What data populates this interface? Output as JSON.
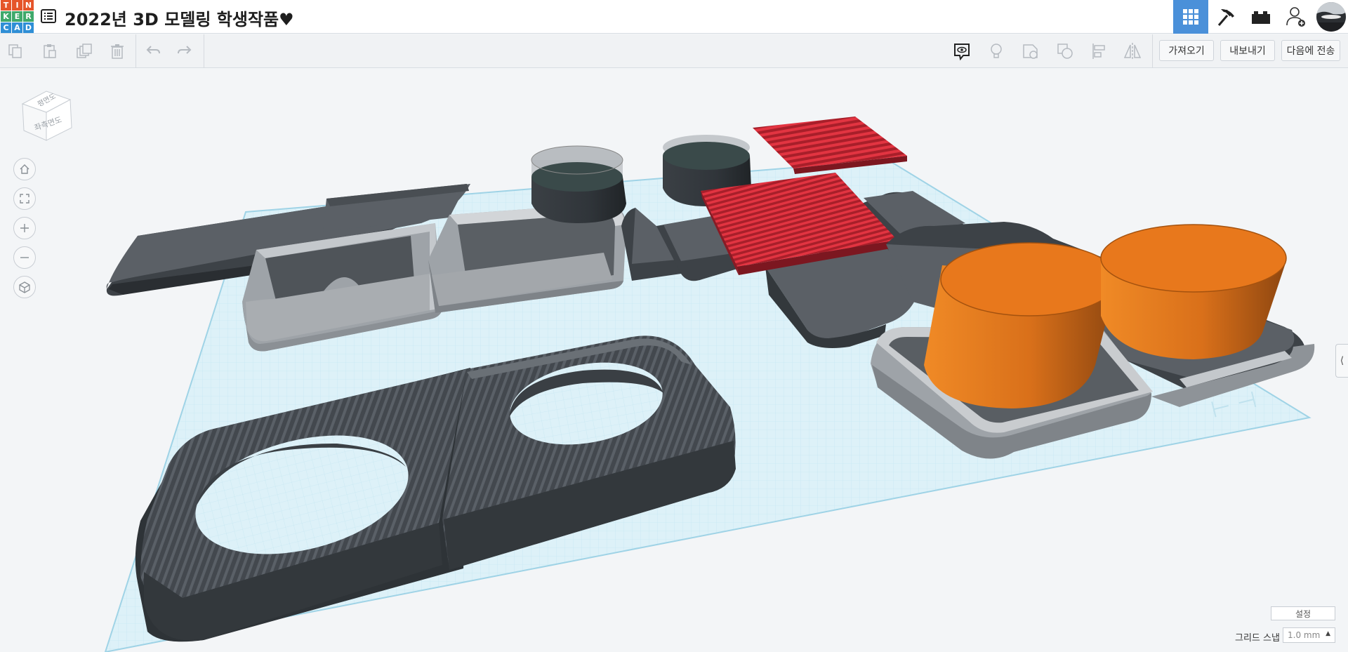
{
  "app": {
    "logo_letters": [
      "T",
      "I",
      "N",
      "K",
      "E",
      "R",
      "C",
      "A",
      "D"
    ],
    "logo_colors": [
      "#e5552a",
      "#e5552a",
      "#e5552a",
      "#3aa6dd",
      "#3aa6dd",
      "#3aa6dd",
      "#3aa6dd",
      "#3aa6dd",
      "#3aa6dd"
    ],
    "title": "2022년 3D 모델링 학생작품♥"
  },
  "header_icons": [
    "grid-view-icon",
    "pickaxe-icon",
    "bricks-icon",
    "add-user-icon",
    "avatar"
  ],
  "toolbar": {
    "left_icons": [
      "copy-icon",
      "paste-icon",
      "duplicate-icon",
      "delete-icon",
      "undo-icon",
      "redo-icon"
    ],
    "right_icons": [
      "notes-icon",
      "light-bulb-icon",
      "shape-icon",
      "group-icon",
      "align-icon",
      "mirror-icon"
    ],
    "import_label": "가져오기",
    "export_label": "내보내기",
    "send_to_label": "다음에 전송"
  },
  "view_cube": {
    "top_label": "평면도",
    "front_label": "좌측면도"
  },
  "nav_controls": [
    "home-view-icon",
    "fit-view-icon",
    "zoom-in-icon",
    "zoom-out-icon",
    "perspective-icon"
  ],
  "bottom": {
    "settings_label": "설정",
    "snap_label": "그리드 스냅",
    "snap_value": "1.0 mm"
  },
  "colors": {
    "accent": "#4a90d9",
    "grid": "#bfe3f0",
    "dark_shape": "#3c4147",
    "light_shape": "#9ea3a8",
    "orange": "#e8781c",
    "red": "#d32433"
  }
}
